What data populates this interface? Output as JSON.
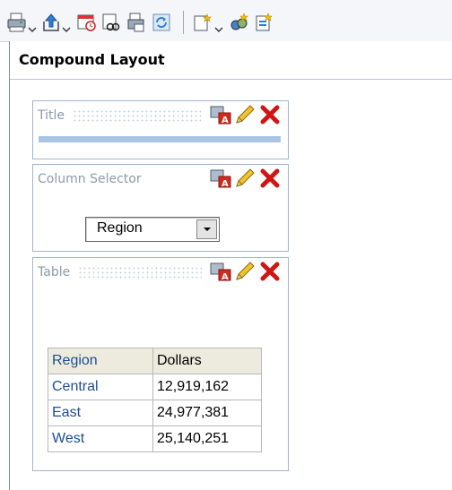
{
  "toolbar": {
    "buttons": [
      {
        "name": "print",
        "has_dropdown": true
      },
      {
        "name": "export",
        "has_dropdown": true
      },
      {
        "name": "schedule"
      },
      {
        "name": "refresh-results"
      },
      {
        "name": "copy"
      },
      {
        "name": "refresh"
      },
      {
        "name": "new-view",
        "has_dropdown": true
      },
      {
        "name": "add-layout"
      },
      {
        "name": "properties"
      }
    ]
  },
  "layout": {
    "title": "Compound Layout"
  },
  "views": [
    {
      "label": "Title"
    },
    {
      "label": "Column Selector",
      "select_value": "Region"
    },
    {
      "label": "Table"
    }
  ],
  "table": {
    "headers": [
      "Region",
      "Dollars"
    ],
    "rows": [
      [
        "Central",
        "12,919,162"
      ],
      [
        "East",
        "24,977,381"
      ],
      [
        "West",
        "25,140,251"
      ]
    ]
  },
  "colors": {
    "link_text": "#1c4d96",
    "header_bg": "#ecebdd",
    "view_border": "#9fb6cc",
    "title_bar": "#aac5e4"
  }
}
